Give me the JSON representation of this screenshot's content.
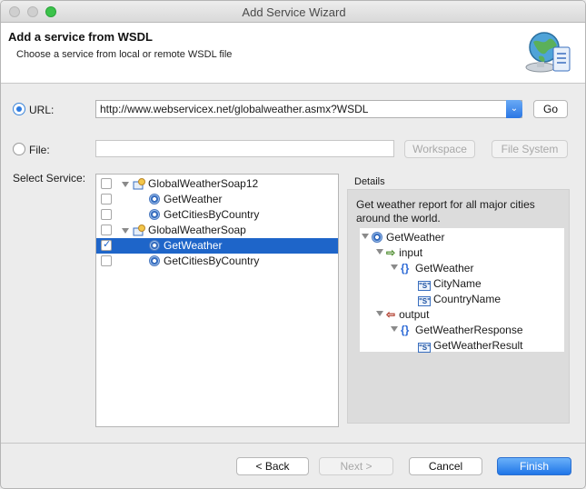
{
  "window": {
    "title": "Add Service Wizard"
  },
  "header": {
    "title": "Add a service from WSDL",
    "subtitle": "Choose a service from local or remote WSDL file",
    "icon": "globe-service-icon"
  },
  "source": {
    "url_label": "URL:",
    "url_value": "http://www.webservicex.net/globalweather.asmx?WSDL",
    "go_label": "Go",
    "file_label": "File:",
    "file_value": "",
    "workspace_label": "Workspace",
    "filesystem_label": "File System",
    "selected": "url"
  },
  "services": {
    "label": "Select Service:",
    "items": [
      {
        "label": "GlobalWeatherSoap12",
        "type": "service",
        "checked": false,
        "selected": false
      },
      {
        "label": "GetWeather",
        "type": "operation",
        "checked": false,
        "selected": false
      },
      {
        "label": "GetCitiesByCountry",
        "type": "operation",
        "checked": false,
        "selected": false
      },
      {
        "label": "GlobalWeatherSoap",
        "type": "service",
        "checked": false,
        "selected": false
      },
      {
        "label": "GetWeather",
        "type": "operation",
        "checked": true,
        "selected": true
      },
      {
        "label": "GetCitiesByCountry",
        "type": "operation",
        "checked": false,
        "selected": false
      }
    ]
  },
  "details": {
    "label": "Details",
    "description": "Get weather report for all major cities around the world.",
    "tree": [
      {
        "label": "GetWeather",
        "kind": "operation"
      },
      {
        "label": "input",
        "kind": "input"
      },
      {
        "label": "GetWeather",
        "kind": "struct"
      },
      {
        "label": "CityName",
        "kind": "string"
      },
      {
        "label": "CountryName",
        "kind": "string"
      },
      {
        "label": "output",
        "kind": "output"
      },
      {
        "label": "GetWeatherResponse",
        "kind": "struct"
      },
      {
        "label": "GetWeatherResult",
        "kind": "string"
      }
    ]
  },
  "footer": {
    "back_label": "< Back",
    "next_label": "Next >",
    "cancel_label": "Cancel",
    "finish_label": "Finish"
  },
  "colors": {
    "selection": "#1e65c9",
    "primary_button": "#1f75e8"
  }
}
